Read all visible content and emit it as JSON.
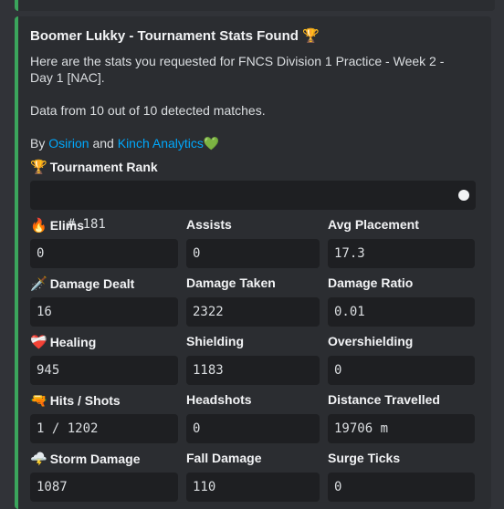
{
  "embed": {
    "title": "Boomer Lukky - Tournament Stats Found",
    "title_emoji": "🏆",
    "desc_line1": "Here are the stats you requested for FNCS Division 1 Practice - Week 2 - Day 1 [NAC].",
    "desc_line2": "Data from 10 out of 10 detected matches.",
    "by_prefix": "By",
    "by_link1": "Osirion",
    "by_and": "and",
    "by_link2": "Kinch Analytics",
    "by_heart": "💚"
  },
  "rank": {
    "emoji": "🏆",
    "label": "Tournament Rank",
    "value": "# 181"
  },
  "rows": [
    [
      {
        "emoji": "🔥",
        "label": "Elims",
        "value": "0"
      },
      {
        "emoji": "",
        "label": "Assists",
        "value": "0"
      },
      {
        "emoji": "",
        "label": "Avg Placement",
        "value": "17.3"
      }
    ],
    [
      {
        "emoji": "🗡️",
        "label": "Damage Dealt",
        "value": "16"
      },
      {
        "emoji": "",
        "label": "Damage Taken",
        "value": "2322"
      },
      {
        "emoji": "",
        "label": "Damage Ratio",
        "value": "0.01"
      }
    ],
    [
      {
        "emoji": "❤️‍🩹",
        "label": "Healing",
        "value": "945"
      },
      {
        "emoji": "",
        "label": "Shielding",
        "value": "1183"
      },
      {
        "emoji": "",
        "label": "Overshielding",
        "value": "0"
      }
    ],
    [
      {
        "emoji": "🔫",
        "label": "Hits / Shots",
        "value": "1 / 1202"
      },
      {
        "emoji": "",
        "label": "Headshots",
        "value": "0"
      },
      {
        "emoji": "",
        "label": "Distance Travelled",
        "value": "19706 m"
      }
    ],
    [
      {
        "emoji": "🌩️",
        "label": "Storm Damage",
        "value": "1087"
      },
      {
        "emoji": "",
        "label": "Fall Damage",
        "value": "110"
      },
      {
        "emoji": "",
        "label": "Surge Ticks",
        "value": "0"
      }
    ]
  ]
}
